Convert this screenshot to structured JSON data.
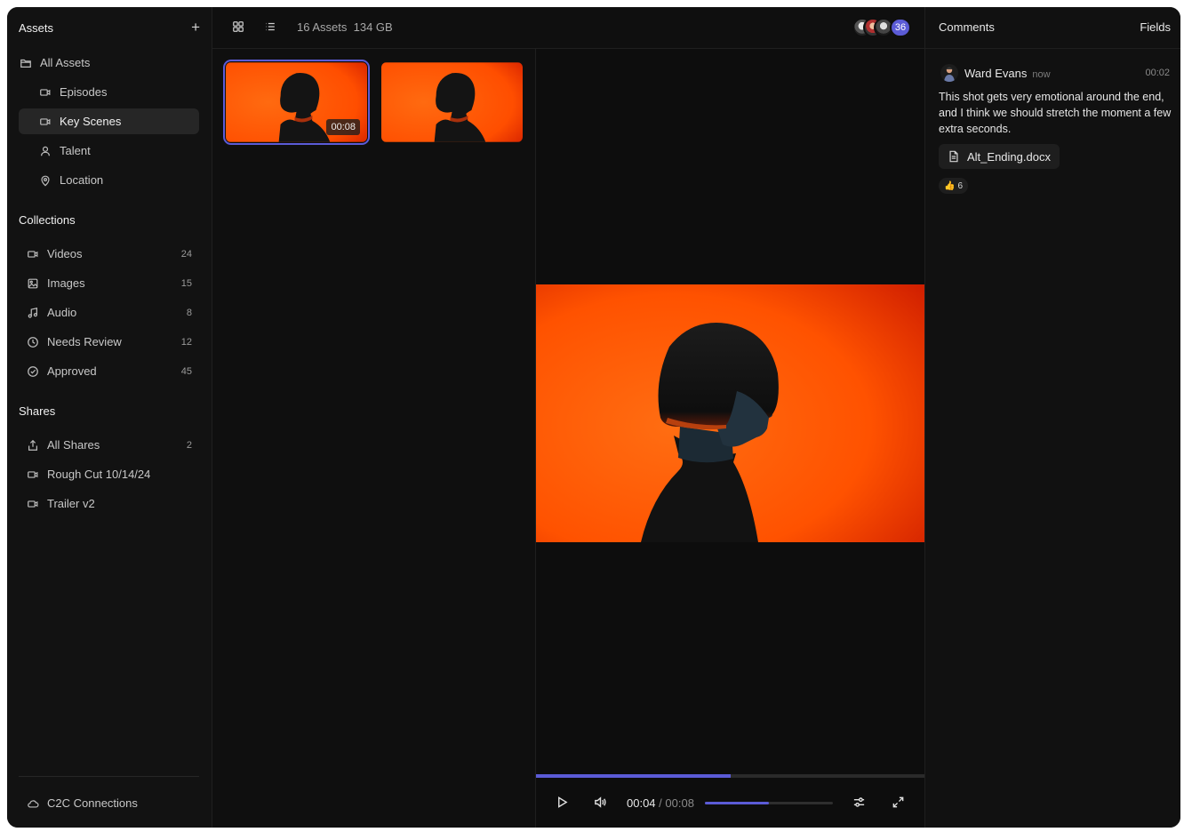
{
  "sidebar": {
    "title": "Assets",
    "add_icon": "plus-icon",
    "library": [
      {
        "label": "All Assets",
        "icon": "folder-icon"
      },
      {
        "label": "Episodes",
        "icon": "video-icon"
      },
      {
        "label": "Key Scenes",
        "icon": "video-icon",
        "active": true
      },
      {
        "label": "Talent",
        "icon": "user-icon"
      },
      {
        "label": "Location",
        "icon": "map-pin-icon"
      }
    ],
    "collections_title": "Collections",
    "collections": [
      {
        "label": "Videos",
        "count": "24",
        "icon": "video-icon"
      },
      {
        "label": "Images",
        "count": "15",
        "icon": "image-icon"
      },
      {
        "label": "Audio",
        "count": "8",
        "icon": "music-icon"
      },
      {
        "label": "Needs Review",
        "count": "12",
        "icon": "clock-icon"
      },
      {
        "label": "Approved",
        "count": "45",
        "icon": "check-circle-icon"
      }
    ],
    "shares_title": "Shares",
    "shares": [
      {
        "label": "All Shares",
        "count": "2",
        "icon": "share-icon"
      },
      {
        "label": "Rough Cut 10/14/24",
        "icon": "video-icon"
      },
      {
        "label": "Trailer v2",
        "icon": "video-icon"
      }
    ],
    "footer": {
      "label": "C2C Connections",
      "icon": "cloud-icon"
    }
  },
  "topbar": {
    "asset_count": "16 Assets",
    "size": "134 GB",
    "avatar_overflow": "36"
  },
  "thumbnails": [
    {
      "duration": "00:08",
      "selected": true
    },
    {
      "duration": "",
      "selected": false
    }
  ],
  "player": {
    "current_time": "00:04",
    "total_time": "00:08",
    "progress": 0.5,
    "volume": 0.5
  },
  "comments": {
    "tab_comments": "Comments",
    "tab_fields": "Fields",
    "items": [
      {
        "author": "Ward Evans",
        "when": "now",
        "timestamp": "00:02",
        "body": "This shot gets very emotional around the end, and I think we should stretch the moment a few extra seconds.",
        "attachment": "Alt_Ending.docx",
        "reaction_emoji": "👍",
        "reaction_count": "6"
      }
    ]
  },
  "colors": {
    "accent": "#5b5bd6",
    "background": "#0f0f0f",
    "orange": "#ff5a00"
  }
}
